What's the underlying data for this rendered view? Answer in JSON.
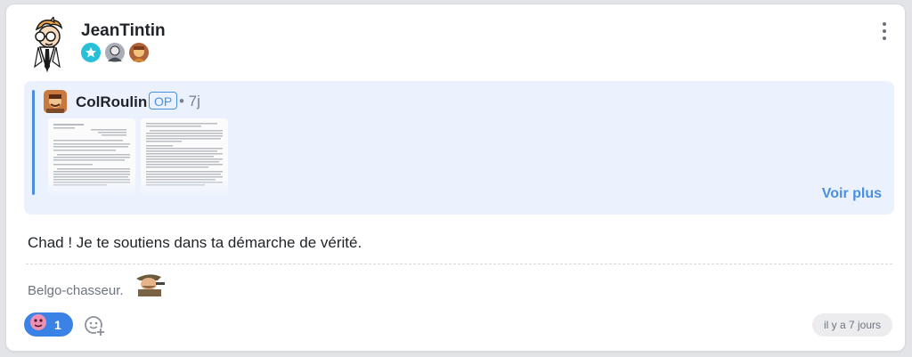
{
  "post": {
    "username": "JeanTintin",
    "badges": [
      "star-badge",
      "portrait-badge",
      "character-badge"
    ],
    "menu_icon": "kebab-icon",
    "quote": {
      "author": "ColRoulin",
      "op_label": "OP",
      "time": "• 7j",
      "see_more": "Voir plus",
      "attachments": [
        "document-thumbnail-1",
        "document-thumbnail-2"
      ]
    },
    "text": "Chad ! Je te soutiens dans ta démarche de vérité.",
    "signature": "Belgo-chasseur.",
    "reactions": [
      {
        "icon": "sticker-reaction-icon",
        "count": "1"
      }
    ],
    "add_reaction_icon": "add-emoji-icon",
    "timestamp": "il y a 7 jours"
  },
  "colors": {
    "accent": "#3b82e6",
    "quote_bg": "#ebf2fd",
    "card_bg": "#ffffff",
    "page_bg": "#e3e4e8"
  }
}
